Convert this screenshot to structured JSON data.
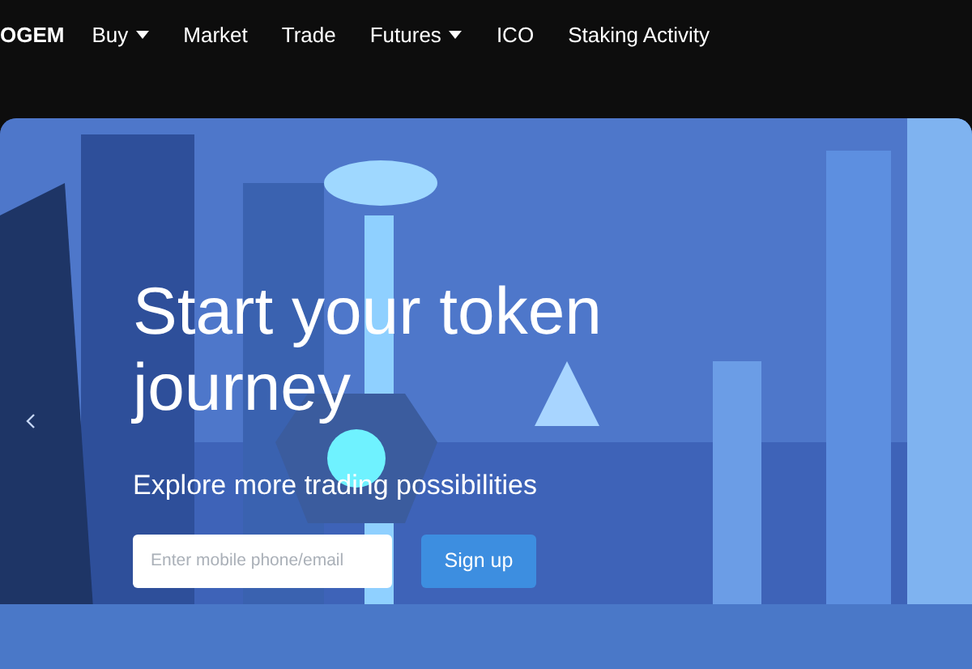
{
  "logo": "OGEM",
  "nav": [
    {
      "label": "Buy",
      "dropdown": true
    },
    {
      "label": "Market",
      "dropdown": false
    },
    {
      "label": "Trade",
      "dropdown": false
    },
    {
      "label": "Futures",
      "dropdown": true
    },
    {
      "label": "ICO",
      "dropdown": false
    },
    {
      "label": "Staking Activity",
      "dropdown": false
    }
  ],
  "hero": {
    "kind": "picture",
    "title": "Start your token journey",
    "subtitle": "Explore more trading possibilities",
    "input": {
      "placeholder": "Enter mobile phone/email"
    },
    "button": "Sign up"
  }
}
